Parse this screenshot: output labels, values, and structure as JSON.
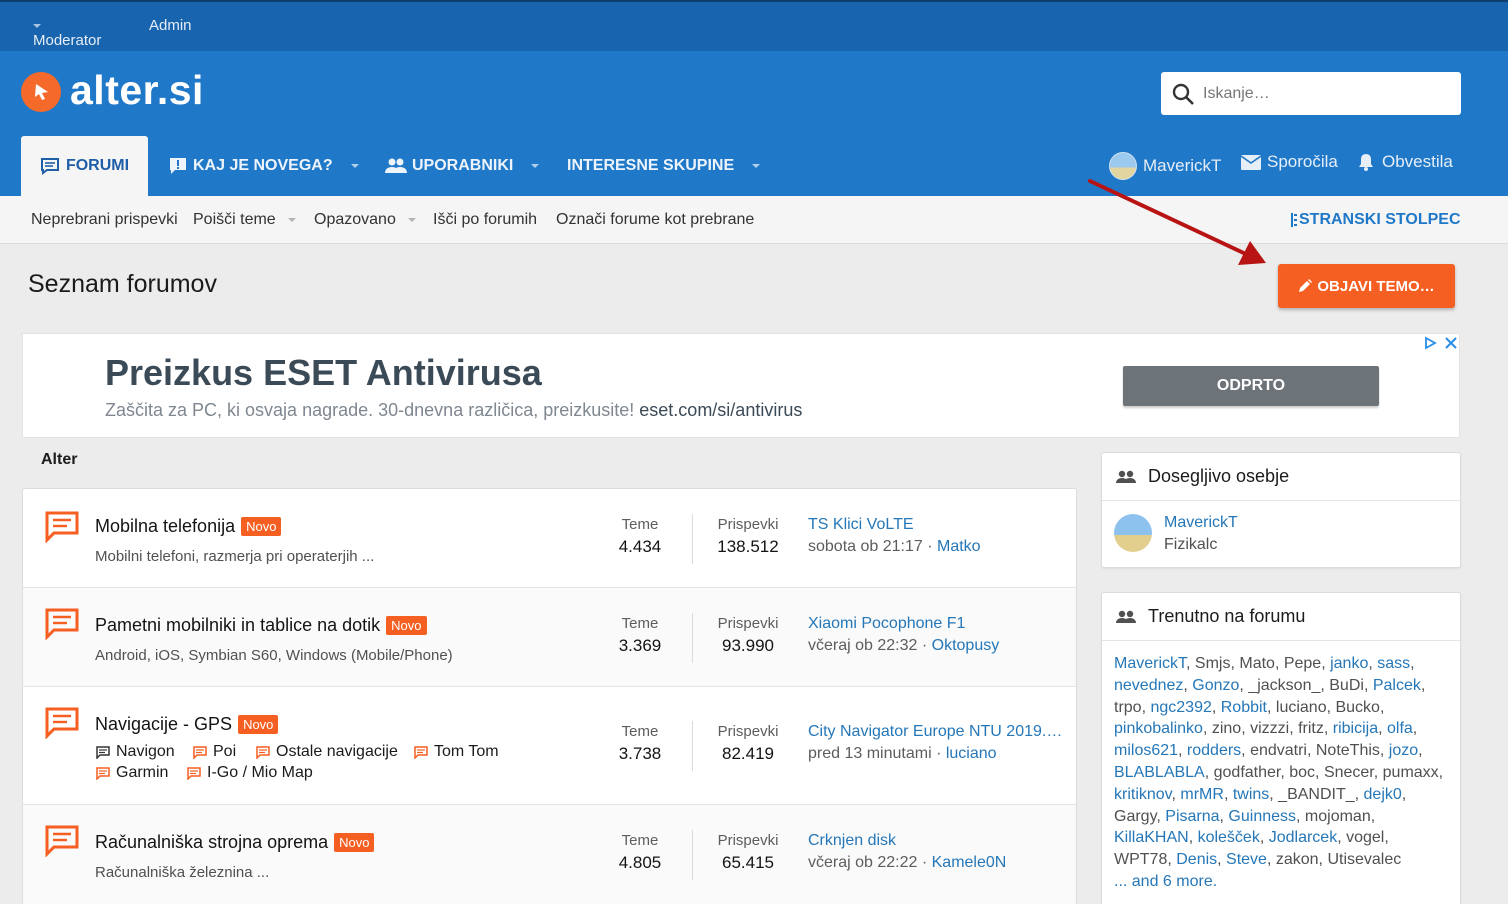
{
  "topbar": {
    "moderator": "Moderator",
    "admin": "Admin"
  },
  "brand": {
    "name": "alter.si",
    "accent": "#f56a2a",
    "header_color": "#1f78c8",
    "topbar_color": "#1964ae"
  },
  "search": {
    "placeholder": "Iskanje…",
    "icon": "search-icon"
  },
  "tabs": {
    "forumi": "FORUMI",
    "novo": "KAJ JE NOVEGA?",
    "uporabniki": "UPORABNIKI",
    "skupine": "INTERESNE SKUPINE"
  },
  "user_nav": {
    "username": "MaverickT",
    "messages": "Sporočila",
    "alerts": "Obvestila"
  },
  "subnav": {
    "items": [
      "Neprebrani prispevki",
      "Poišči teme",
      "Opazovano",
      "Išči po forumih",
      "Označi forume kot prebrane"
    ],
    "sidebar_toggle": "STRANSKI STOLPEC"
  },
  "page": {
    "title": "Seznam forumov",
    "post_button": "OBJAVI TEMO…",
    "post_color": "#f55f22"
  },
  "ad": {
    "title": "Preizkus ESET Antivirusa",
    "subtitle": "Zaščita za PC, ki osvaja nagrade. 30-dnevna različica, preizkusite!",
    "domain": "eset.com/si/antivirus",
    "button": "ODPRTO"
  },
  "category": {
    "title": "Alter"
  },
  "forums": [
    {
      "name": "Mobilna telefonija",
      "badge": "Novo",
      "description": "Mobilni telefoni, razmerja pri operaterjih ...",
      "threads_label": "Teme",
      "threads": "4.434",
      "posts_label": "Prispevki",
      "posts": "138.512",
      "last_title": "TS Klici VoLTE",
      "last_time": "sobota ob 21:17",
      "last_user": "Matko"
    },
    {
      "name": "Pametni mobilniki in tablice na dotik",
      "badge": "Novo",
      "description": "Android, iOS, Symbian S60, Windows (Mobile/Phone)",
      "threads_label": "Teme",
      "threads": "3.369",
      "posts_label": "Prispevki",
      "posts": "93.990",
      "last_title": "Xiaomi Pocophone F1",
      "last_time": "včeraj ob 22:32",
      "last_user": "Oktopusy"
    },
    {
      "name": "Navigacije - GPS",
      "badge": "Novo",
      "subforums": [
        "Navigon",
        "Poi",
        "Ostale navigacije",
        "Tom Tom",
        "Garmin",
        "I-Go / Mio Map"
      ],
      "threads_label": "Teme",
      "threads": "3.738",
      "posts_label": "Prispevki",
      "posts": "82.419",
      "last_title": "City Navigator Europe NTU 2019.2...",
      "last_time": "pred 13 minutami",
      "last_user": "luciano"
    },
    {
      "name": "Računalniška strojna oprema",
      "badge": "Novo",
      "description": "Računalniška železnina ...",
      "threads_label": "Teme",
      "threads": "4.805",
      "posts_label": "Prispevki",
      "posts": "65.415",
      "last_title": "Crknjen disk",
      "last_time": "včeraj ob 22:22",
      "last_user": "Kamele0N"
    }
  ],
  "staff": {
    "title": "Dosegljivo osebje",
    "name": "MaverickT",
    "role": "Fizikalc"
  },
  "online": {
    "title": "Trenutno na forumu",
    "users": [
      {
        "n": "MaverickT",
        "l": true
      },
      {
        "n": "Smjs",
        "l": false
      },
      {
        "n": "Mato",
        "l": false
      },
      {
        "n": "Pepe",
        "l": false
      },
      {
        "n": "janko",
        "l": true
      },
      {
        "n": "sass",
        "l": true
      },
      {
        "n": "nevednez",
        "l": true
      },
      {
        "n": "Gonzo",
        "l": true
      },
      {
        "n": "_jackson_",
        "l": false
      },
      {
        "n": "BuDi",
        "l": false
      },
      {
        "n": "Palcek",
        "l": true
      },
      {
        "n": "trpo",
        "l": false
      },
      {
        "n": "ngc2392",
        "l": true
      },
      {
        "n": "Robbit",
        "l": true
      },
      {
        "n": "luciano",
        "l": false
      },
      {
        "n": "Bucko",
        "l": false
      },
      {
        "n": "pinkobalinko",
        "l": true
      },
      {
        "n": "zino",
        "l": false
      },
      {
        "n": "vizzzi",
        "l": false
      },
      {
        "n": "fritz",
        "l": false
      },
      {
        "n": "ribicija",
        "l": true
      },
      {
        "n": "olfa",
        "l": true
      },
      {
        "n": "milos621",
        "l": true
      },
      {
        "n": "rodders",
        "l": true
      },
      {
        "n": "endvatri",
        "l": false
      },
      {
        "n": "NoteThis",
        "l": false
      },
      {
        "n": "jozo",
        "l": true
      },
      {
        "n": "BLABLABLA",
        "l": true
      },
      {
        "n": "godfather",
        "l": false
      },
      {
        "n": "boc",
        "l": false
      },
      {
        "n": "Snecer",
        "l": false
      },
      {
        "n": "pumaxx",
        "l": false
      },
      {
        "n": "kritiknov",
        "l": true
      },
      {
        "n": "mrMR",
        "l": true
      },
      {
        "n": "twins",
        "l": true
      },
      {
        "n": "_BANDIT_",
        "l": false
      },
      {
        "n": "dejk0",
        "l": true
      },
      {
        "n": "Gargy",
        "l": false
      },
      {
        "n": "Pisarna",
        "l": true
      },
      {
        "n": "Guinness",
        "l": true
      },
      {
        "n": "mojoman",
        "l": false
      },
      {
        "n": "KillaKHAN",
        "l": true
      },
      {
        "n": "kolešček",
        "l": true
      },
      {
        "n": "Jodlarcek",
        "l": true
      },
      {
        "n": "vogel",
        "l": false
      },
      {
        "n": "WPT78",
        "l": false
      },
      {
        "n": "Denis",
        "l": true
      },
      {
        "n": "Steve",
        "l": true
      },
      {
        "n": "zakon",
        "l": false
      },
      {
        "n": "Utisevalec",
        "l": false
      }
    ],
    "more": "... and 6 more."
  }
}
